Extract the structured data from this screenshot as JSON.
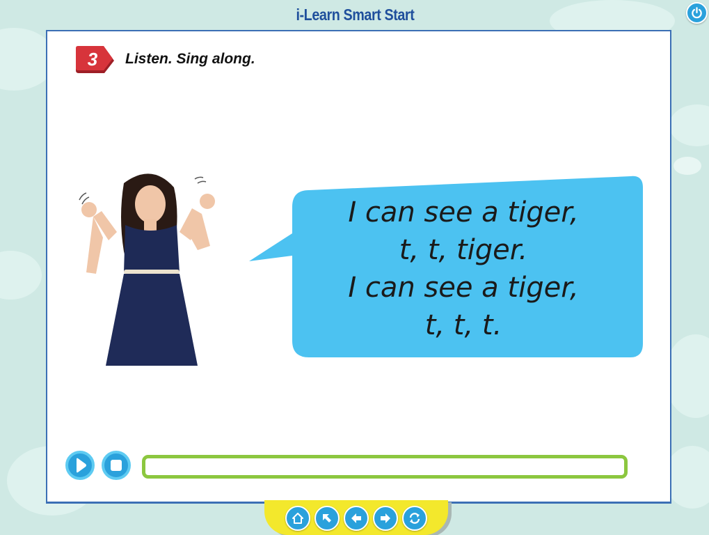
{
  "app": {
    "title": "i-Learn Smart Start"
  },
  "exercise": {
    "number": "3",
    "title": "Listen. Sing along."
  },
  "bubble": {
    "lines": [
      "I can see a tiger,",
      "t, t, tiger.",
      "I can see a tiger,",
      "t, t, t."
    ]
  },
  "player": {
    "progress": 0
  },
  "icons": {
    "power": "power-icon",
    "play": "play-icon",
    "stop": "stop-icon",
    "home": "home-icon",
    "up": "arrow-up-left-icon",
    "back": "arrow-left-icon",
    "next": "arrow-right-icon",
    "refresh": "refresh-icon"
  },
  "colors": {
    "background": "#cfe9e4",
    "title": "#1f4f9c",
    "accent_blue": "#2aa1dc",
    "bubble": "#4cc2f1",
    "badge": "#d7343b",
    "progress": "#8cc73f",
    "nav_bar": "#f3e82c"
  }
}
